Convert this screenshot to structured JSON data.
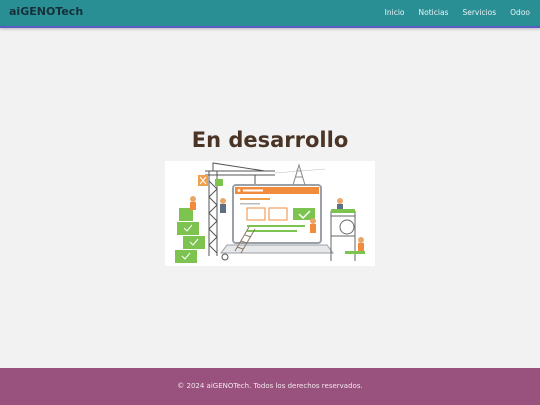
{
  "navbar": {
    "brand": "aiGENOTech",
    "links": [
      "Inicio",
      "Noticias",
      "Servicios",
      "Odoo"
    ]
  },
  "main": {
    "title": "En desarrollo",
    "illustration_icon": "under-construction-illustration"
  },
  "footer": {
    "text": "© 2024 aiGENOTech. Todos los derechos reservados."
  },
  "colors": {
    "navbar": "#2a8f95",
    "footer": "#98527d",
    "title": "#4a3426"
  }
}
